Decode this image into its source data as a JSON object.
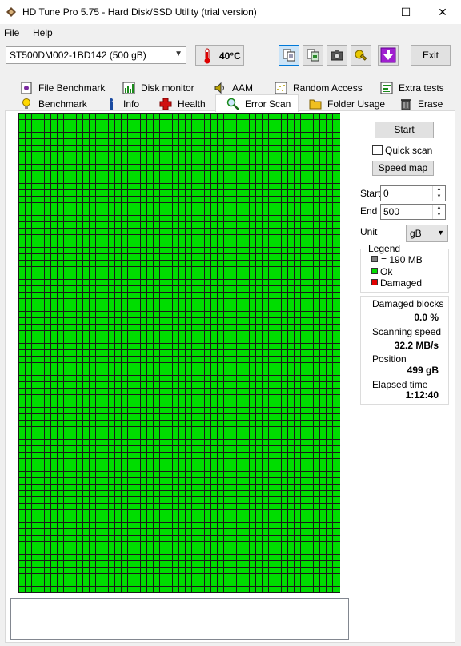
{
  "window": {
    "title": "HD Tune Pro 5.75 - Hard Disk/SSD Utility (trial version)",
    "minimize": "—",
    "maximize": "☐",
    "close": "✕"
  },
  "menu": {
    "file": "File",
    "help": "Help"
  },
  "toolbar": {
    "drive": "ST500DM002-1BD142 (500 gB)",
    "temperature": "40°C",
    "exit_label": "Exit"
  },
  "tabs_top": [
    {
      "label": "File Benchmark",
      "icon": "file-benchmark-icon"
    },
    {
      "label": "Disk monitor",
      "icon": "disk-monitor-icon"
    },
    {
      "label": "AAM",
      "icon": "speaker-icon"
    },
    {
      "label": "Random Access",
      "icon": "random-access-icon"
    },
    {
      "label": "Extra tests",
      "icon": "extra-tests-icon"
    }
  ],
  "tabs_bottom": [
    {
      "label": "Benchmark",
      "icon": "lightbulb-icon"
    },
    {
      "label": "Info",
      "icon": "info-icon"
    },
    {
      "label": "Health",
      "icon": "health-cross-icon"
    },
    {
      "label": "Error Scan",
      "icon": "magnifier-icon"
    },
    {
      "label": "Folder Usage",
      "icon": "folder-icon"
    },
    {
      "label": "Erase",
      "icon": "trash-icon"
    }
  ],
  "scan": {
    "start_button": "Start",
    "quick_scan_label": "Quick scan",
    "quick_scan_checked": false,
    "speed_map_button": "Speed map",
    "start_label": "Start",
    "start_value": "0",
    "end_label": "End",
    "end_value": "500",
    "unit_label": "Unit",
    "unit_value": "gB"
  },
  "legend": {
    "title": "Legend",
    "block_label": "= 190 MB",
    "ok_label": "Ok",
    "damaged_label": "Damaged",
    "block_color": "#808080",
    "ok_color": "#00dd00",
    "damaged_color": "#e00000"
  },
  "stats": {
    "damaged_blocks_label": "Damaged blocks",
    "damaged_blocks_value": "0.0 %",
    "scanning_speed_label": "Scanning speed",
    "scanning_speed_value": "32.2 MB/s",
    "position_label": "Position",
    "position_value": "499 gB",
    "elapsed_label": "Elapsed time",
    "elapsed_value": "1:12:40"
  },
  "grid": {
    "status": "all blocks ok",
    "ok_color": "#00dd00"
  }
}
